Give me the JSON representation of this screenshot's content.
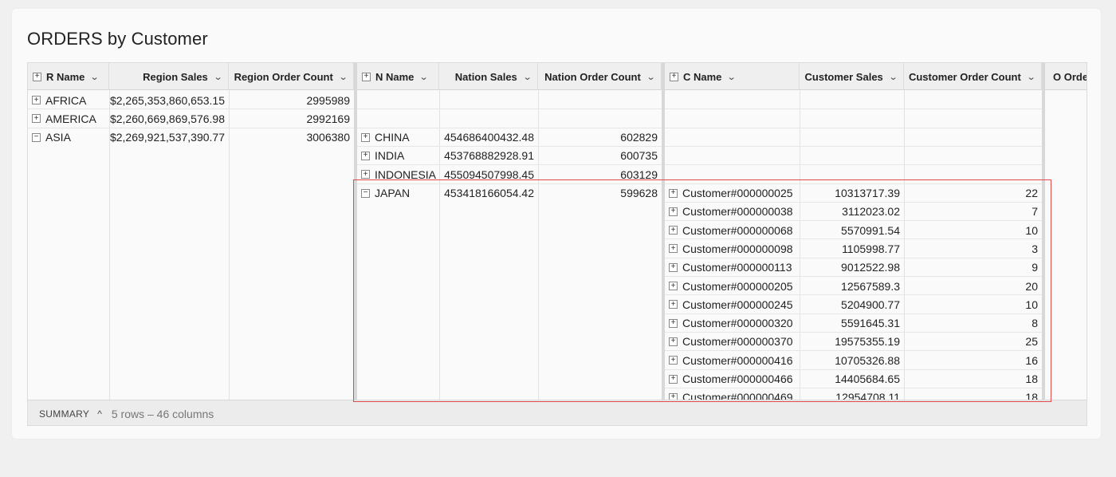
{
  "title": "ORDERS by Customer",
  "headers": {
    "r_name": "R Name",
    "region_sales": "Region Sales",
    "region_order_count": "Region Order Count",
    "n_name": "N Name",
    "nation_sales": "Nation Sales",
    "nation_order_count": "Nation Order Count",
    "c_name": "C Name",
    "customer_sales": "Customer Sales",
    "customer_order_count": "Customer Order Count",
    "o_order": "O Orde"
  },
  "regions": [
    {
      "toggle": "+",
      "name": "AFRICA",
      "sales": "$2,265,353,860,653.15",
      "count": "2995989"
    },
    {
      "toggle": "+",
      "name": "AMERICA",
      "sales": "$2,260,669,869,576.98",
      "count": "2992169"
    },
    {
      "toggle": "−",
      "name": "ASIA",
      "sales": "$2,269,921,537,390.77",
      "count": "3006380"
    }
  ],
  "nations": [
    {
      "toggle": "+",
      "name": "CHINA",
      "sales": "454686400432.48",
      "count": "602829"
    },
    {
      "toggle": "+",
      "name": "INDIA",
      "sales": "453768882928.91",
      "count": "600735"
    },
    {
      "toggle": "+",
      "name": "INDONESIA",
      "sales": "455094507998.45",
      "count": "603129"
    },
    {
      "toggle": "−",
      "name": "JAPAN",
      "sales": "453418166054.42",
      "count": "599628"
    }
  ],
  "customers": [
    {
      "toggle": "+",
      "name": "Customer#000000025",
      "sales": "10313717.39",
      "count": "22"
    },
    {
      "toggle": "+",
      "name": "Customer#000000038",
      "sales": "3112023.02",
      "count": "7"
    },
    {
      "toggle": "+",
      "name": "Customer#000000068",
      "sales": "5570991.54",
      "count": "10"
    },
    {
      "toggle": "+",
      "name": "Customer#000000098",
      "sales": "1105998.77",
      "count": "3"
    },
    {
      "toggle": "+",
      "name": "Customer#000000113",
      "sales": "9012522.98",
      "count": "9"
    },
    {
      "toggle": "+",
      "name": "Customer#000000205",
      "sales": "12567589.3",
      "count": "20"
    },
    {
      "toggle": "+",
      "name": "Customer#000000245",
      "sales": "5204900.77",
      "count": "10"
    },
    {
      "toggle": "+",
      "name": "Customer#000000320",
      "sales": "5591645.31",
      "count": "8"
    },
    {
      "toggle": "+",
      "name": "Customer#000000370",
      "sales": "19575355.19",
      "count": "25"
    },
    {
      "toggle": "+",
      "name": "Customer#000000416",
      "sales": "10705326.88",
      "count": "16"
    },
    {
      "toggle": "+",
      "name": "Customer#000000466",
      "sales": "14405684.65",
      "count": "18"
    },
    {
      "toggle": "+",
      "name": "Customer#000000469",
      "sales": "12954708.11",
      "count": "18"
    }
  ],
  "footer": {
    "summary": "SUMMARY",
    "caret": "^",
    "info": "5 rows – 46 columns"
  },
  "icons": {
    "expand": "plus-box-icon",
    "collapse": "minus-box-icon",
    "sort": "chevron-down-icon"
  },
  "colors": {
    "highlight": "#e14b4b"
  }
}
